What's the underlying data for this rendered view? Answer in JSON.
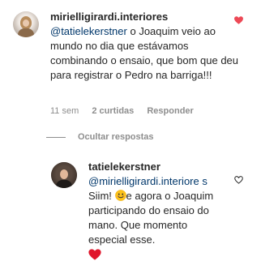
{
  "comment1": {
    "username": "mirielligirardi.interiores",
    "mention": "@tatielekerstner",
    "text": " o Joaquim veio ao mundo no dia que estávamos combinando o ensaio, que bom que deu para registrar o Pedro na barriga!!!",
    "time": "11 sem",
    "likes": "2 curtidas",
    "reply": "Responder",
    "liked": true
  },
  "hide_replies": "Ocultar respostas",
  "comment2": {
    "username": "tatielekerstner",
    "mention": "@mirielligirardi.interiore s",
    "text_a": " Siim! ",
    "emoji": "smiling-face",
    "text_b": "e agora o Joaquim participando do ensaio do mano. Que momento especial esse.",
    "end_emoji": "red-heart",
    "liked": false
  },
  "colors": {
    "text": "#262626",
    "mention": "#00376b",
    "meta": "#8e8e8e",
    "like_red": "#ed4956"
  }
}
